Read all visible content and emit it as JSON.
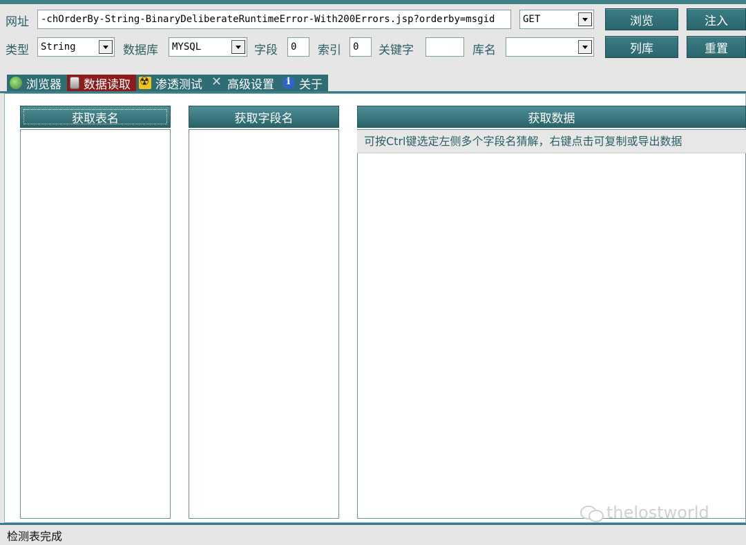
{
  "toolbar": {
    "url_label": "网址",
    "url_value": "-chOrderBy-String-BinaryDeliberateRuntimeError-With200Errors.jsp?orderby=msgid",
    "method_value": "GET",
    "browse_button": "浏览",
    "inject_button": "注入",
    "type_label": "类型",
    "type_value": "String",
    "database_label": "数据库",
    "database_value": "MYSQL",
    "field_label": "字段",
    "field_value": "0",
    "index_label": "索引",
    "index_value": "0",
    "keyword_label": "关键字",
    "keyword_value": "",
    "dbname_label": "库名",
    "dbname_value": "",
    "list_db_button": "列库",
    "reset_button": "重置"
  },
  "tabs": [
    {
      "label": "浏览器",
      "icon": "globe-icon",
      "active": false
    },
    {
      "label": "数据读取",
      "icon": "database-icon",
      "active": true
    },
    {
      "label": "渗透测试",
      "icon": "radiation-icon",
      "active": false
    },
    {
      "label": "高级设置",
      "icon": "tools-icon",
      "active": false
    },
    {
      "label": "关于",
      "icon": "info-icon",
      "active": false
    }
  ],
  "panels": {
    "get_tables_label": "获取表名",
    "get_fields_label": "获取字段名",
    "get_data_label": "获取数据",
    "data_hint": "可按Ctrl键选定左侧多个字段名猜解，右键点击可复制或导出数据"
  },
  "watermark": "thelostworld",
  "status": {
    "text": "检测表完成"
  }
}
